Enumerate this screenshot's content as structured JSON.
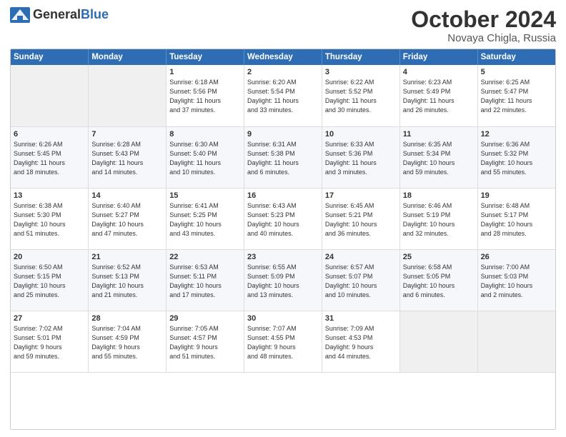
{
  "header": {
    "logo_general": "General",
    "logo_blue": "Blue",
    "month": "October 2024",
    "location": "Novaya Chigla, Russia"
  },
  "days_of_week": [
    "Sunday",
    "Monday",
    "Tuesday",
    "Wednesday",
    "Thursday",
    "Friday",
    "Saturday"
  ],
  "weeks": [
    [
      {
        "day": "",
        "info": ""
      },
      {
        "day": "",
        "info": ""
      },
      {
        "day": "1",
        "info": "Sunrise: 6:18 AM\nSunset: 5:56 PM\nDaylight: 11 hours\nand 37 minutes."
      },
      {
        "day": "2",
        "info": "Sunrise: 6:20 AM\nSunset: 5:54 PM\nDaylight: 11 hours\nand 33 minutes."
      },
      {
        "day": "3",
        "info": "Sunrise: 6:22 AM\nSunset: 5:52 PM\nDaylight: 11 hours\nand 30 minutes."
      },
      {
        "day": "4",
        "info": "Sunrise: 6:23 AM\nSunset: 5:49 PM\nDaylight: 11 hours\nand 26 minutes."
      },
      {
        "day": "5",
        "info": "Sunrise: 6:25 AM\nSunset: 5:47 PM\nDaylight: 11 hours\nand 22 minutes."
      }
    ],
    [
      {
        "day": "6",
        "info": "Sunrise: 6:26 AM\nSunset: 5:45 PM\nDaylight: 11 hours\nand 18 minutes."
      },
      {
        "day": "7",
        "info": "Sunrise: 6:28 AM\nSunset: 5:43 PM\nDaylight: 11 hours\nand 14 minutes."
      },
      {
        "day": "8",
        "info": "Sunrise: 6:30 AM\nSunset: 5:40 PM\nDaylight: 11 hours\nand 10 minutes."
      },
      {
        "day": "9",
        "info": "Sunrise: 6:31 AM\nSunset: 5:38 PM\nDaylight: 11 hours\nand 6 minutes."
      },
      {
        "day": "10",
        "info": "Sunrise: 6:33 AM\nSunset: 5:36 PM\nDaylight: 11 hours\nand 3 minutes."
      },
      {
        "day": "11",
        "info": "Sunrise: 6:35 AM\nSunset: 5:34 PM\nDaylight: 10 hours\nand 59 minutes."
      },
      {
        "day": "12",
        "info": "Sunrise: 6:36 AM\nSunset: 5:32 PM\nDaylight: 10 hours\nand 55 minutes."
      }
    ],
    [
      {
        "day": "13",
        "info": "Sunrise: 6:38 AM\nSunset: 5:30 PM\nDaylight: 10 hours\nand 51 minutes."
      },
      {
        "day": "14",
        "info": "Sunrise: 6:40 AM\nSunset: 5:27 PM\nDaylight: 10 hours\nand 47 minutes."
      },
      {
        "day": "15",
        "info": "Sunrise: 6:41 AM\nSunset: 5:25 PM\nDaylight: 10 hours\nand 43 minutes."
      },
      {
        "day": "16",
        "info": "Sunrise: 6:43 AM\nSunset: 5:23 PM\nDaylight: 10 hours\nand 40 minutes."
      },
      {
        "day": "17",
        "info": "Sunrise: 6:45 AM\nSunset: 5:21 PM\nDaylight: 10 hours\nand 36 minutes."
      },
      {
        "day": "18",
        "info": "Sunrise: 6:46 AM\nSunset: 5:19 PM\nDaylight: 10 hours\nand 32 minutes."
      },
      {
        "day": "19",
        "info": "Sunrise: 6:48 AM\nSunset: 5:17 PM\nDaylight: 10 hours\nand 28 minutes."
      }
    ],
    [
      {
        "day": "20",
        "info": "Sunrise: 6:50 AM\nSunset: 5:15 PM\nDaylight: 10 hours\nand 25 minutes."
      },
      {
        "day": "21",
        "info": "Sunrise: 6:52 AM\nSunset: 5:13 PM\nDaylight: 10 hours\nand 21 minutes."
      },
      {
        "day": "22",
        "info": "Sunrise: 6:53 AM\nSunset: 5:11 PM\nDaylight: 10 hours\nand 17 minutes."
      },
      {
        "day": "23",
        "info": "Sunrise: 6:55 AM\nSunset: 5:09 PM\nDaylight: 10 hours\nand 13 minutes."
      },
      {
        "day": "24",
        "info": "Sunrise: 6:57 AM\nSunset: 5:07 PM\nDaylight: 10 hours\nand 10 minutes."
      },
      {
        "day": "25",
        "info": "Sunrise: 6:58 AM\nSunset: 5:05 PM\nDaylight: 10 hours\nand 6 minutes."
      },
      {
        "day": "26",
        "info": "Sunrise: 7:00 AM\nSunset: 5:03 PM\nDaylight: 10 hours\nand 2 minutes."
      }
    ],
    [
      {
        "day": "27",
        "info": "Sunrise: 7:02 AM\nSunset: 5:01 PM\nDaylight: 9 hours\nand 59 minutes."
      },
      {
        "day": "28",
        "info": "Sunrise: 7:04 AM\nSunset: 4:59 PM\nDaylight: 9 hours\nand 55 minutes."
      },
      {
        "day": "29",
        "info": "Sunrise: 7:05 AM\nSunset: 4:57 PM\nDaylight: 9 hours\nand 51 minutes."
      },
      {
        "day": "30",
        "info": "Sunrise: 7:07 AM\nSunset: 4:55 PM\nDaylight: 9 hours\nand 48 minutes."
      },
      {
        "day": "31",
        "info": "Sunrise: 7:09 AM\nSunset: 4:53 PM\nDaylight: 9 hours\nand 44 minutes."
      },
      {
        "day": "",
        "info": ""
      },
      {
        "day": "",
        "info": ""
      }
    ]
  ]
}
